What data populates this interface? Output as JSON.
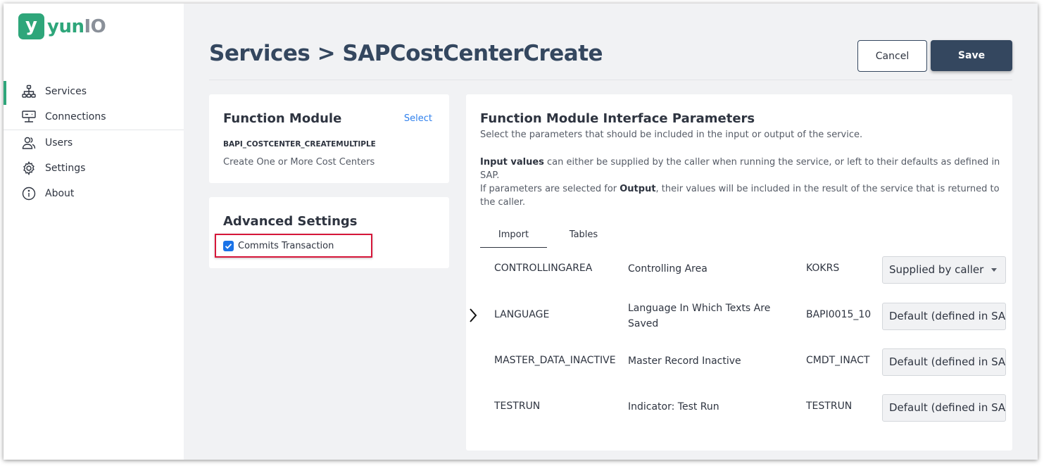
{
  "app": {
    "logo_letter": "y",
    "logo_text_a": "yun",
    "logo_text_b": "IO"
  },
  "sidebar": {
    "items": [
      {
        "label": "Services",
        "icon": "sitemap-icon",
        "active": true
      },
      {
        "label": "Connections",
        "icon": "server-icon"
      },
      {
        "label": "Users",
        "icon": "users-icon"
      },
      {
        "label": "Settings",
        "icon": "gear-icon"
      },
      {
        "label": "About",
        "icon": "info-icon"
      }
    ]
  },
  "header": {
    "title": "Services > SAPCostCenterCreate",
    "cancel_label": "Cancel",
    "save_label": "Save"
  },
  "function_module": {
    "title": "Function Module",
    "select_label": "Select",
    "name": "BAPI_COSTCENTER_CREATEMULTIPLE",
    "description": "Create One or More Cost Centers"
  },
  "advanced": {
    "title": "Advanced Settings",
    "commit_label": "Commits Transaction",
    "commit_checked": true
  },
  "params": {
    "title": "Function Module Interface Parameters",
    "intro": "Select the parameters that should be included in the input or output of the service.",
    "input_bold": "Input values",
    "input_rest": " can either be supplied by the caller when running the service, or left to their defaults as defined in SAP.",
    "output_pre": "If parameters are selected for ",
    "output_bold": "Output",
    "output_rest": ", their values will be included in the result of the service that is returned to the caller.",
    "tabs": [
      "Import",
      "Tables"
    ],
    "rows": [
      {
        "name": "CONTROLLINGAREA",
        "description": "Controlling Area",
        "type": "KOKRS",
        "value": "Supplied by caller"
      },
      {
        "name": "LANGUAGE",
        "description": "Language In Which Texts Are Saved",
        "type": "BAPI0015_10",
        "value": "Default (defined in SAP)"
      },
      {
        "name": "MASTER_DATA_INACTIVE",
        "description": "Master Record Inactive",
        "type": "CMDT_INACT",
        "value": "Default (defined in SAP)"
      },
      {
        "name": "TESTRUN",
        "description": "Indicator: Test Run",
        "type": "TESTRUN",
        "value": "Default (defined in SAP)"
      }
    ]
  },
  "colors": {
    "brand": "#2ea67a",
    "primary": "#34475f",
    "highlight": "#d6173a",
    "link": "#2f80ed"
  }
}
